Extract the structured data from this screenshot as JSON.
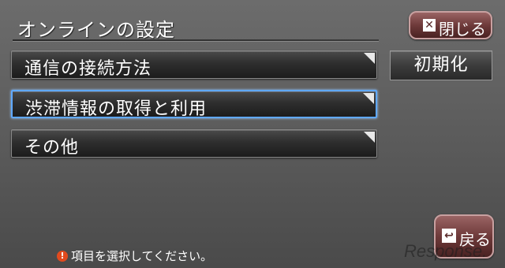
{
  "header": {
    "title": "オンラインの設定"
  },
  "menu": {
    "items": [
      {
        "label": "通信の接続方法",
        "selected": false
      },
      {
        "label": "渋滞情報の取得と利用",
        "selected": true
      },
      {
        "label": "その他",
        "selected": false
      }
    ]
  },
  "buttons": {
    "close_label": "閉じる",
    "close_icon": "✕",
    "init_label": "初期化",
    "back_label": "戻る",
    "back_icon": "↩"
  },
  "status": {
    "hint": "項目を選択してください。",
    "info_icon": "!"
  },
  "watermark": {
    "text": "Response."
  },
  "colors": {
    "accent_selected": "#5fa8ff",
    "button_red": "#6e3a3a",
    "info_orange": "#e24a1e"
  }
}
